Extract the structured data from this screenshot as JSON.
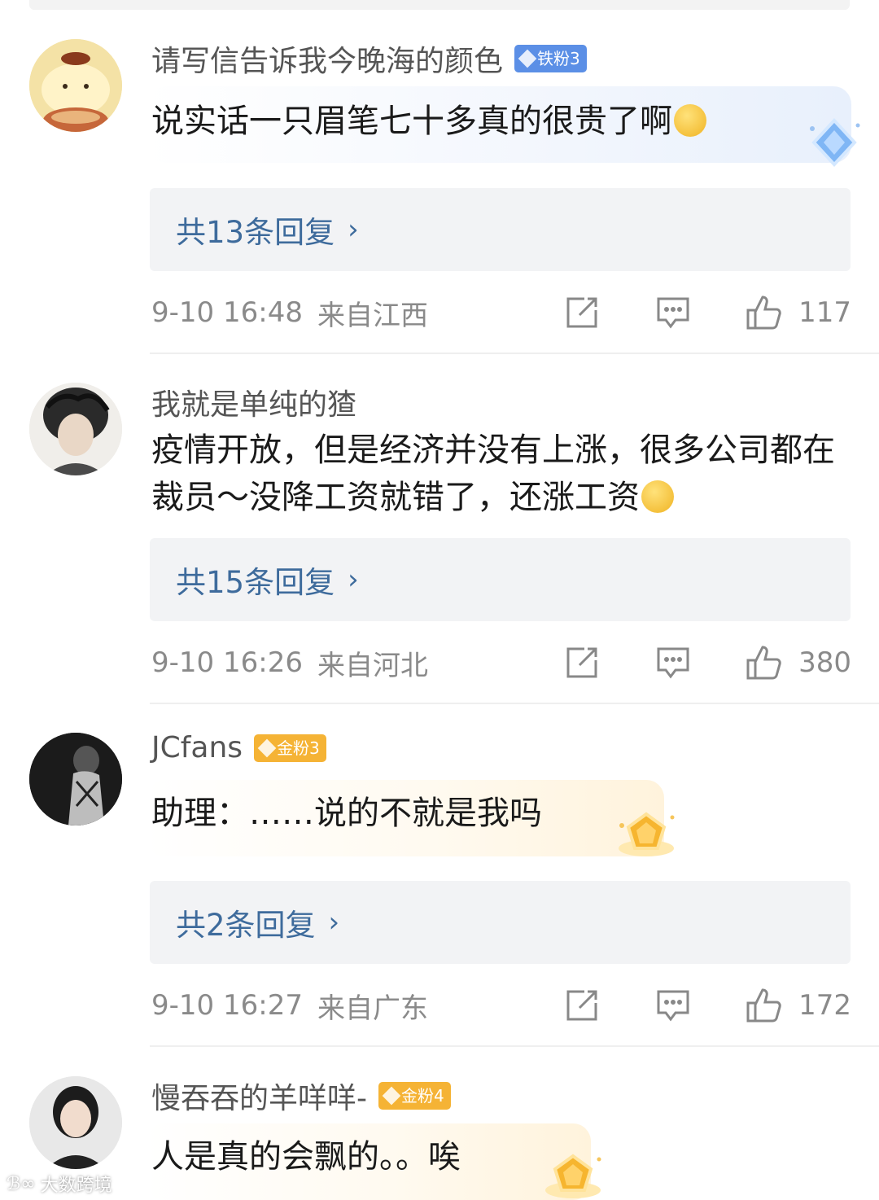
{
  "comments": [
    {
      "username": "请写信告诉我今晚海的颜色",
      "badge": "铁粉3",
      "text": "说实话一只眉笔七十多真的很贵了啊",
      "replies": "共13条回复",
      "time": "9-10 16:48",
      "location": "来自江西",
      "likes": "117"
    },
    {
      "username": "我就是单纯的猹",
      "badge": "",
      "text": "疫情开放，但是经济并没有上涨，很多公司都在裁员～没降工资就错了，还涨工资",
      "replies": "共15条回复",
      "time": "9-10 16:26",
      "location": "来自河北",
      "likes": "380"
    },
    {
      "username": "JCfans",
      "badge": "金粉3",
      "text": "助理：……说的不就是我吗",
      "replies": "共2条回复",
      "time": "9-10 16:27",
      "location": "来自广东",
      "likes": "172"
    },
    {
      "username": "慢吞吞的羊咩咩-",
      "badge": "金粉4",
      "text": "人是真的会飘的。。唉"
    }
  ],
  "watermark": "大数跨境",
  "colors": {
    "link_blue": "#3e6b9c",
    "iron_badge": "#5b8fe6",
    "gold_badge": "#f5b335",
    "reply_bg": "#f2f3f5"
  },
  "icons": [
    "share-icon",
    "comment-icon",
    "like-icon",
    "chevron-right-icon"
  ]
}
